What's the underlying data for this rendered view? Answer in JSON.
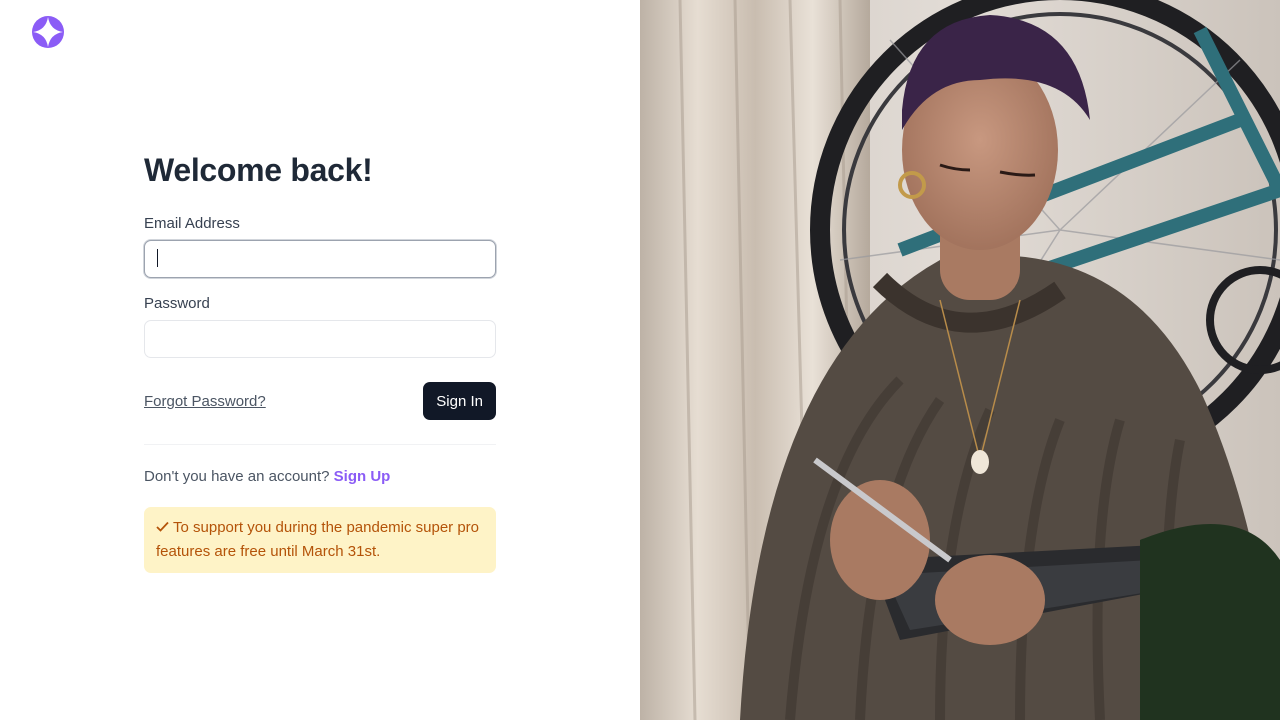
{
  "brand": {
    "logo_icon": "compass-star-icon",
    "accent": "#8b5cf6"
  },
  "login": {
    "title": "Welcome back!",
    "email_label": "Email Address",
    "email_value": "",
    "password_label": "Password",
    "password_value": "",
    "forgot_link": "Forgot Password?",
    "signin_button": "Sign In",
    "no_account_text": "Don't you have an account?",
    "signup_link": "Sign Up"
  },
  "notice": {
    "icon": "check-icon",
    "text": "To support you during the pandemic super pro features are free until March 31st."
  },
  "colors": {
    "button_bg": "#111827",
    "notice_bg": "#fef3c7",
    "notice_text": "#b45309"
  }
}
